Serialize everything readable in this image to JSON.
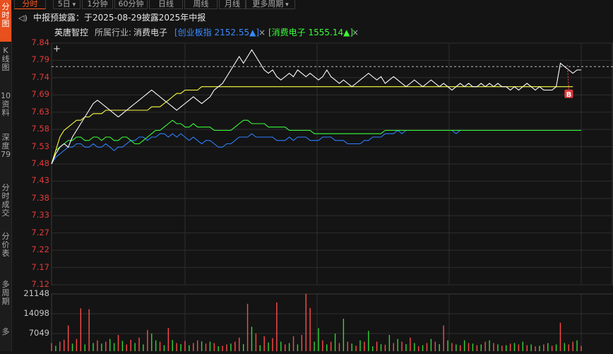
{
  "sidebar": {
    "items": [
      "分时图",
      "K线图",
      "10资料",
      "深度79",
      "分时成交",
      "分价表",
      "多周期",
      "多"
    ]
  },
  "tabs": [
    {
      "label": "分时"
    },
    {
      "label": "5日",
      "dropdown": true
    },
    {
      "label": "1分钟"
    },
    {
      "label": "60分钟"
    },
    {
      "label": "日线"
    },
    {
      "label": "周线"
    },
    {
      "label": "月线"
    },
    {
      "label": "更多周期",
      "dropdown": true
    }
  ],
  "notice": {
    "text": "中报预披露：于2025-08-29披露2025年中报"
  },
  "info": {
    "stock": "英唐智控",
    "industry_label": "所属行业:",
    "industry": "消费电子",
    "index1": "[创业板指 2152.55▲]",
    "index2": "[消费电子 1555.14▲]",
    "close": "×"
  },
  "marker": "B",
  "colors": {
    "price": "#ffffff",
    "avg": "#ffff44",
    "index1": "#2f7fff",
    "index2": "#3aff3a",
    "up": "#ff4a4a",
    "down": "#35d435",
    "grid": "#3a3a3a"
  },
  "chart_data": {
    "type": "line",
    "y_ticks": [
      "7.84",
      "7.79",
      "7.74",
      "7.69",
      "7.63",
      "7.58",
      "7.53",
      "7.48",
      "7.43",
      "7.38",
      "7.33",
      "7.27",
      "7.22",
      "7.17",
      "7.12"
    ],
    "ylim": [
      7.12,
      7.84
    ],
    "ref_price": 7.77,
    "volume_ticks": [
      "21148",
      "14098",
      "7049"
    ],
    "volume_max": 21148,
    "series": [
      {
        "key": "price",
        "values": [
          7.48,
          7.51,
          7.53,
          7.54,
          7.53,
          7.56,
          7.58,
          7.6,
          7.62,
          7.64,
          7.66,
          7.67,
          7.66,
          7.65,
          7.64,
          7.63,
          7.62,
          7.63,
          7.64,
          7.65,
          7.66,
          7.67,
          7.68,
          7.69,
          7.7,
          7.69,
          7.68,
          7.67,
          7.66,
          7.65,
          7.64,
          7.65,
          7.66,
          7.67,
          7.68,
          7.67,
          7.66,
          7.67,
          7.68,
          7.7,
          7.71,
          7.72,
          7.74,
          7.76,
          7.78,
          7.8,
          7.78,
          7.8,
          7.82,
          7.8,
          7.78,
          7.76,
          7.75,
          7.76,
          7.74,
          7.73,
          7.74,
          7.75,
          7.74,
          7.76,
          7.75,
          7.74,
          7.75,
          7.74,
          7.73,
          7.74,
          7.76,
          7.74,
          7.73,
          7.72,
          7.73,
          7.72,
          7.71,
          7.72,
          7.73,
          7.74,
          7.75,
          7.74,
          7.73,
          7.74,
          7.72,
          7.73,
          7.74,
          7.73,
          7.72,
          7.71,
          7.72,
          7.73,
          7.72,
          7.71,
          7.72,
          7.73,
          7.72,
          7.71,
          7.72,
          7.71,
          7.7,
          7.71,
          7.72,
          7.71,
          7.72,
          7.71,
          7.71,
          7.72,
          7.71,
          7.72,
          7.71,
          7.72,
          7.71,
          7.71,
          7.7,
          7.71,
          7.7,
          7.71,
          7.72,
          7.71,
          7.7,
          7.71,
          7.7,
          7.7,
          7.7,
          7.71,
          7.78,
          7.77,
          7.76,
          7.75,
          7.76,
          7.76
        ]
      },
      {
        "key": "avg",
        "values": [
          7.48,
          7.52,
          7.56,
          7.58,
          7.59,
          7.6,
          7.61,
          7.61,
          7.62,
          7.62,
          7.63,
          7.63,
          7.63,
          7.64,
          7.64,
          7.64,
          7.64,
          7.64,
          7.64,
          7.64,
          7.64,
          7.64,
          7.64,
          7.64,
          7.65,
          7.65,
          7.65,
          7.66,
          7.67,
          7.68,
          7.69,
          7.69,
          7.7,
          7.7,
          7.7,
          7.7,
          7.71,
          7.71,
          7.71,
          7.71,
          7.71,
          7.71,
          7.71,
          7.71,
          7.71,
          7.71,
          7.71,
          7.71,
          7.71,
          7.71,
          7.71,
          7.71,
          7.71,
          7.71,
          7.71,
          7.71,
          7.71,
          7.71,
          7.71,
          7.71,
          7.71,
          7.71,
          7.71,
          7.71,
          7.71,
          7.71,
          7.71,
          7.71,
          7.71,
          7.71,
          7.71,
          7.71,
          7.71,
          7.71,
          7.71,
          7.71,
          7.71,
          7.71,
          7.71,
          7.71,
          7.71,
          7.71,
          7.71,
          7.71,
          7.71,
          7.71,
          7.71,
          7.71,
          7.71,
          7.71,
          7.71,
          7.71,
          7.71,
          7.71,
          7.71,
          7.71,
          7.71,
          7.71,
          7.71,
          7.71,
          7.71,
          7.71,
          7.71,
          7.71,
          7.71,
          7.71,
          7.71,
          7.71,
          7.71,
          7.71,
          7.71,
          7.71,
          7.71,
          7.71,
          7.71,
          7.71,
          7.71,
          7.71,
          7.71,
          7.71,
          7.71,
          7.71,
          7.71,
          7.71,
          7.71,
          7.71
        ]
      },
      {
        "key": "index1",
        "values": [
          7.48,
          7.5,
          7.51,
          7.52,
          7.53,
          7.53,
          7.54,
          7.54,
          7.53,
          7.53,
          7.54,
          7.53,
          7.53,
          7.54,
          7.53,
          7.52,
          7.53,
          7.53,
          7.54,
          7.55,
          7.55,
          7.56,
          7.56,
          7.55,
          7.56,
          7.56,
          7.57,
          7.57,
          7.56,
          7.57,
          7.56,
          7.57,
          7.56,
          7.55,
          7.56,
          7.55,
          7.54,
          7.55,
          7.55,
          7.54,
          7.53,
          7.53,
          7.54,
          7.54,
          7.55,
          7.56,
          7.56,
          7.56,
          7.57,
          7.56,
          7.56,
          7.56,
          7.56,
          7.56,
          7.55,
          7.55,
          7.55,
          7.56,
          7.55,
          7.56,
          7.56,
          7.56,
          7.55,
          7.55,
          7.55,
          7.56,
          7.56,
          7.56,
          7.55,
          7.55,
          7.55,
          7.54,
          7.54,
          7.54,
          7.54,
          7.55,
          7.55,
          7.56,
          7.56,
          7.56,
          7.57,
          7.57,
          7.57,
          7.58,
          7.57,
          7.58,
          7.58,
          7.58,
          7.58,
          7.58,
          7.58,
          7.58,
          7.58,
          7.58,
          7.58,
          7.58,
          7.58,
          7.57,
          7.58,
          7.58,
          7.58,
          7.58,
          7.58,
          7.58,
          7.58,
          7.58,
          7.58,
          7.58,
          7.58,
          7.58,
          7.58,
          7.58,
          7.58,
          7.58,
          7.58,
          7.58,
          7.58,
          7.58,
          7.58,
          7.58,
          7.58,
          7.58,
          7.58,
          7.58,
          7.58,
          7.58,
          7.58,
          7.58
        ]
      },
      {
        "key": "index2",
        "values": [
          7.48,
          7.52,
          7.53,
          7.54,
          7.55,
          7.55,
          7.56,
          7.56,
          7.55,
          7.55,
          7.56,
          7.56,
          7.55,
          7.56,
          7.56,
          7.55,
          7.55,
          7.56,
          7.56,
          7.55,
          7.54,
          7.54,
          7.55,
          7.56,
          7.57,
          7.58,
          7.58,
          7.59,
          7.6,
          7.61,
          7.6,
          7.6,
          7.59,
          7.59,
          7.6,
          7.59,
          7.59,
          7.59,
          7.59,
          7.58,
          7.58,
          7.58,
          7.58,
          7.58,
          7.59,
          7.6,
          7.61,
          7.61,
          7.6,
          7.6,
          7.6,
          7.6,
          7.59,
          7.59,
          7.59,
          7.59,
          7.59,
          7.58,
          7.58,
          7.58,
          7.58,
          7.58,
          7.58,
          7.57,
          7.57,
          7.57,
          7.57,
          7.57,
          7.57,
          7.57,
          7.57,
          7.57,
          7.57,
          7.57,
          7.57,
          7.57,
          7.57,
          7.57,
          7.57,
          7.57,
          7.58,
          7.58,
          7.58,
          7.58,
          7.58,
          7.58,
          7.58,
          7.58,
          7.58,
          7.58,
          7.58,
          7.58,
          7.58,
          7.58,
          7.58,
          7.58,
          7.58,
          7.58,
          7.58,
          7.58,
          7.58,
          7.58,
          7.58,
          7.58,
          7.58,
          7.58,
          7.58,
          7.58,
          7.58,
          7.58,
          7.58,
          7.58,
          7.58,
          7.58,
          7.58,
          7.58,
          7.58,
          7.58,
          7.58,
          7.58,
          7.58,
          7.58,
          7.58,
          7.58,
          7.58,
          7.58,
          7.58,
          7.58
        ]
      }
    ],
    "volume": [
      3000,
      2000,
      3500,
      4200,
      9500,
      2800,
      4500,
      15800,
      2500,
      15500,
      3000,
      4000,
      2800,
      3500,
      4500,
      3000,
      6000,
      3800,
      2500,
      4200,
      3000,
      5000,
      2500,
      7800,
      6500,
      4000,
      3500,
      2200,
      8600,
      4100,
      3000,
      2600,
      3800,
      2200,
      3000,
      4000,
      3600,
      2800,
      3500,
      3000,
      1800,
      2000,
      2500,
      2800,
      3500,
      5000,
      2600,
      17500,
      9000,
      6500,
      2200,
      5500,
      3200,
      4800,
      18000,
      3500,
      2500,
      3000,
      5500,
      2500,
      6000,
      21148,
      16000,
      3500,
      8500,
      4000,
      2500,
      3500,
      6500,
      3000,
      12000,
      3500,
      2800,
      2000,
      4000,
      3500,
      7500,
      1800,
      3500,
      2600,
      2400,
      6000,
      3000,
      4500,
      3500,
      2600,
      5000,
      3000,
      1800,
      2200,
      3000,
      4500,
      3500,
      2600,
      9500,
      4000,
      3000,
      2500,
      2200,
      4000,
      3000,
      2800,
      2200,
      2500,
      3500,
      4000,
      3000,
      2500,
      2000,
      2200,
      2800,
      3000,
      2500,
      3500,
      2200,
      2500,
      1800,
      2000,
      2500,
      3000,
      2000,
      2500,
      10500,
      3000,
      2500,
      3500,
      4000,
      2000
    ],
    "volume_dir": [
      "u",
      "d",
      "u",
      "u",
      "u",
      "d",
      "u",
      "u",
      "d",
      "u",
      "d",
      "u",
      "d",
      "u",
      "d",
      "d",
      "u",
      "d",
      "u",
      "u",
      "d",
      "u",
      "d",
      "u",
      "d",
      "d",
      "u",
      "d",
      "u",
      "d",
      "u",
      "d",
      "u",
      "d",
      "u",
      "u",
      "d",
      "u",
      "d",
      "u",
      "d",
      "u",
      "u",
      "d",
      "u",
      "u",
      "d",
      "u",
      "d",
      "u",
      "d",
      "u",
      "d",
      "u",
      "u",
      "d",
      "u",
      "d",
      "u",
      "d",
      "u",
      "u",
      "u",
      "d",
      "d",
      "u",
      "d",
      "u",
      "d",
      "u",
      "d",
      "u",
      "d",
      "u",
      "d",
      "u",
      "d",
      "d",
      "u",
      "d",
      "u",
      "d",
      "u",
      "d",
      "u",
      "d",
      "u",
      "d",
      "u",
      "d",
      "u",
      "d",
      "u",
      "d",
      "u",
      "d",
      "u",
      "d",
      "u",
      "d",
      "u",
      "d",
      "u",
      "d",
      "u",
      "d",
      "u",
      "d",
      "u",
      "d",
      "u",
      "d",
      "u",
      "d",
      "u",
      "d",
      "u",
      "d",
      "u",
      "d",
      "u",
      "d",
      "u",
      "d",
      "u",
      "u",
      "d",
      "u"
    ]
  }
}
